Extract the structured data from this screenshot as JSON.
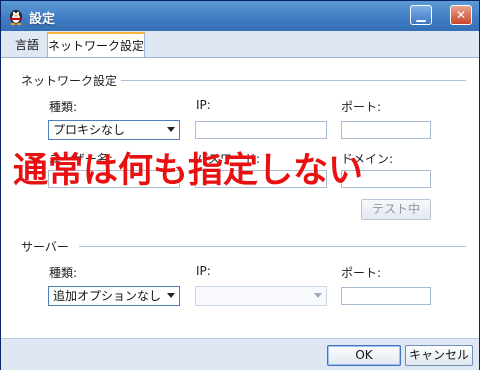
{
  "window": {
    "title": "設定"
  },
  "tabs": [
    {
      "label": "言語"
    },
    {
      "label": "ネットワーク設定"
    }
  ],
  "network": {
    "section_title": "ネットワーク設定",
    "type_label": "種類:",
    "type_value": "プロキシなし",
    "ip_label": "IP:",
    "ip_value": "",
    "port_label": "ポート:",
    "port_value": "",
    "username_label": "ユーザー名:",
    "username_value": "",
    "password_label": "パスワード:",
    "password_value": "",
    "domain_label": "ドメイン:",
    "domain_value": "",
    "test_button": "テスト中"
  },
  "annotation": "通常は何も指定しない",
  "server": {
    "section_title": "サーバー",
    "type_label": "種類:",
    "type_value": "追加オプションなし",
    "ip_label": "IP:",
    "ip_value": "",
    "port_label": "ポート:",
    "port_value": ""
  },
  "footer": {
    "ok": "OK",
    "cancel": "キャンセル"
  },
  "colors": {
    "accent": "#3f7cc2",
    "annotation": "#e81010",
    "tab_highlight": "#ffb339"
  }
}
